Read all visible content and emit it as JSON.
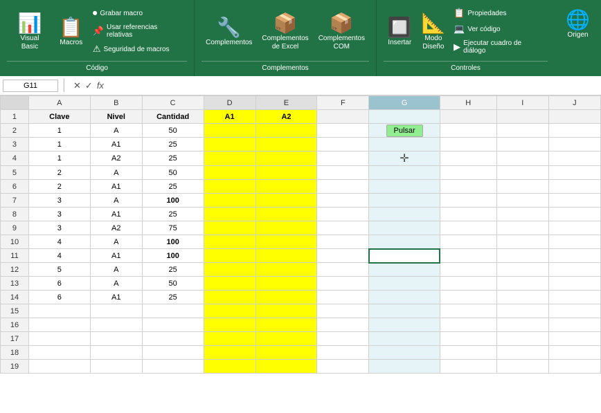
{
  "ribbon": {
    "sections": {
      "codigo": {
        "label": "Código",
        "items": [
          {
            "id": "visual-basic",
            "label": "Visual\nBasic",
            "icon": "📊"
          },
          {
            "id": "macros",
            "label": "Macros",
            "icon": "📋"
          },
          {
            "id": "grabar-macro",
            "label": "Grabar macro",
            "icon": "⏺"
          },
          {
            "id": "usar-referencias",
            "label": "Usar referencias relativas",
            "icon": "📌"
          },
          {
            "id": "seguridad",
            "label": "Seguridad de macros",
            "icon": "⚠"
          }
        ]
      },
      "complementos": {
        "label": "Complementos",
        "items": [
          {
            "id": "complementos",
            "label": "Complementos",
            "icon": "🔧"
          },
          {
            "id": "complementos-excel",
            "label": "Complementos\nde Excel",
            "icon": "📦"
          },
          {
            "id": "complementos-com",
            "label": "Complementos\nCOM",
            "icon": "📦"
          }
        ]
      },
      "controles": {
        "label": "Controles",
        "items": [
          {
            "id": "insertar",
            "label": "Insertar",
            "icon": "🔲"
          },
          {
            "id": "modo-diseno",
            "label": "Modo\nDiseño",
            "icon": "📐"
          },
          {
            "id": "propiedades",
            "label": "Propiedades",
            "icon": "📋"
          },
          {
            "id": "ver-codigo",
            "label": "Ver código",
            "icon": "💻"
          },
          {
            "id": "ejecutar-cuadro",
            "label": "Ejecutar cuadro de diálogo",
            "icon": "▶"
          },
          {
            "id": "origen",
            "label": "Origen",
            "icon": "🌐"
          }
        ]
      }
    }
  },
  "formula_bar": {
    "cell_ref": "G11",
    "cancel_label": "✕",
    "confirm_label": "✓",
    "formula_label": "fx",
    "formula_value": ""
  },
  "sheet": {
    "active_cell": "G11",
    "selected_col": "G",
    "columns": [
      "A",
      "B",
      "C",
      "D",
      "E",
      "F",
      "G",
      "H",
      "I",
      "J"
    ],
    "headers": [
      "Clave",
      "Nivel",
      "Cantidad",
      "A1",
      "A2",
      "",
      "",
      "",
      "",
      ""
    ],
    "rows": [
      {
        "num": 1,
        "a": "Clave",
        "b": "Nivel",
        "c": "Cantidad",
        "d": "A1",
        "e": "A2",
        "f": "",
        "g": "",
        "h": "",
        "i": "",
        "j": ""
      },
      {
        "num": 2,
        "a": "1",
        "b": "A",
        "c": "50",
        "d": "",
        "e": "",
        "f": "",
        "g": "Pulsar",
        "h": "",
        "i": "",
        "j": ""
      },
      {
        "num": 3,
        "a": "1",
        "b": "A1",
        "c": "25",
        "d": "",
        "e": "",
        "f": "",
        "g": "",
        "h": "",
        "i": "",
        "j": ""
      },
      {
        "num": 4,
        "a": "1",
        "b": "A2",
        "c": "25",
        "d": "",
        "e": "",
        "f": "",
        "g": "✛",
        "h": "",
        "i": "",
        "j": ""
      },
      {
        "num": 5,
        "a": "2",
        "b": "A",
        "c": "50",
        "d": "",
        "e": "",
        "f": "",
        "g": "",
        "h": "",
        "i": "",
        "j": ""
      },
      {
        "num": 6,
        "a": "2",
        "b": "A1",
        "c": "25",
        "d": "",
        "e": "",
        "f": "",
        "g": "",
        "h": "",
        "i": "",
        "j": ""
      },
      {
        "num": 7,
        "a": "3",
        "b": "A",
        "c": "100",
        "d": "",
        "e": "",
        "f": "",
        "g": "",
        "h": "",
        "i": "",
        "j": ""
      },
      {
        "num": 8,
        "a": "3",
        "b": "A1",
        "c": "25",
        "d": "",
        "e": "",
        "f": "",
        "g": "",
        "h": "",
        "i": "",
        "j": ""
      },
      {
        "num": 9,
        "a": "3",
        "b": "A2",
        "c": "75",
        "d": "",
        "e": "",
        "f": "",
        "g": "",
        "h": "",
        "i": "",
        "j": ""
      },
      {
        "num": 10,
        "a": "4",
        "b": "A",
        "c": "100",
        "d": "",
        "e": "",
        "f": "",
        "g": "",
        "h": "",
        "i": "",
        "j": ""
      },
      {
        "num": 11,
        "a": "4",
        "b": "A1",
        "c": "100",
        "d": "",
        "e": "",
        "f": "",
        "g": "",
        "h": "",
        "i": "",
        "j": ""
      },
      {
        "num": 12,
        "a": "5",
        "b": "A",
        "c": "25",
        "d": "",
        "e": "",
        "f": "",
        "g": "",
        "h": "",
        "i": "",
        "j": ""
      },
      {
        "num": 13,
        "a": "6",
        "b": "A",
        "c": "50",
        "d": "",
        "e": "",
        "f": "",
        "g": "",
        "h": "",
        "i": "",
        "j": ""
      },
      {
        "num": 14,
        "a": "6",
        "b": "A1",
        "c": "25",
        "d": "",
        "e": "",
        "f": "",
        "g": "",
        "h": "",
        "i": "",
        "j": ""
      },
      {
        "num": 15,
        "a": "",
        "b": "",
        "c": "",
        "d": "",
        "e": "",
        "f": "",
        "g": "",
        "h": "",
        "i": "",
        "j": ""
      },
      {
        "num": 16,
        "a": "",
        "b": "",
        "c": "",
        "d": "",
        "e": "",
        "f": "",
        "g": "",
        "h": "",
        "i": "",
        "j": ""
      },
      {
        "num": 17,
        "a": "",
        "b": "",
        "c": "",
        "d": "",
        "e": "",
        "f": "",
        "g": "",
        "h": "",
        "i": "",
        "j": ""
      },
      {
        "num": 18,
        "a": "",
        "b": "",
        "c": "",
        "d": "",
        "e": "",
        "f": "",
        "g": "",
        "h": "",
        "i": "",
        "j": ""
      },
      {
        "num": 19,
        "a": "",
        "b": "",
        "c": "",
        "d": "",
        "e": "",
        "f": "",
        "g": "",
        "h": "",
        "i": "",
        "j": ""
      }
    ],
    "bold_rows": [
      7,
      10,
      11
    ],
    "pulsar_button": "Pulsar"
  }
}
